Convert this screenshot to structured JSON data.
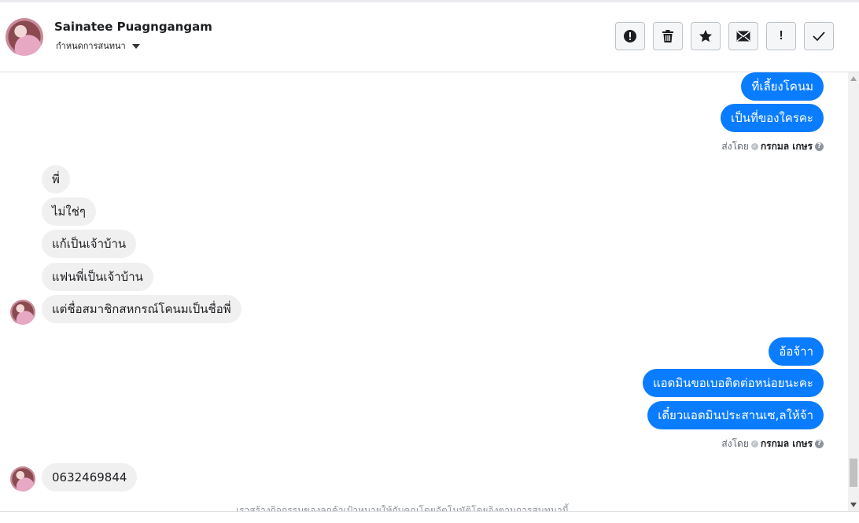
{
  "header": {
    "contact_name": "Sainatee Puagngangam",
    "subtitle": "กำหนดการสนทนา",
    "toolbar": {
      "spam_icon": "exclamation-circle-icon",
      "delete_icon": "trash-icon",
      "star_icon": "star-icon",
      "mail_icon": "envelope-icon",
      "important_label": "!",
      "done_icon": "checkmark-icon"
    }
  },
  "messages": {
    "out1": "ที่เลี้ยงโคนม",
    "out2": "เป็นที่ของใครคะ",
    "sent_by_1": {
      "prefix": "ส่งโดย",
      "sender": "กรกมล เกษร"
    },
    "in1": "พี่",
    "in2": "ไม่ใช่ๆ",
    "in3": "แก้เป็นเจ้าบ้าน",
    "in4": "แฟนพี่เป็นเจ้าบ้าน",
    "in5": "แต่ชื่อสมาชิกสหกรณ์โคนมเป็นชื่อพี่",
    "out3": "อ้อจ้าา",
    "out4": "แอดมินขอเบอติดต่อหน่อยนะคะ",
    "out5": "เดี๋ยวแอดมินประสานเซ,ลให้จ้า",
    "sent_by_2": {
      "prefix": "ส่งโดย",
      "sender": "กรกมล เกษร"
    },
    "in6": "0632469844"
  },
  "footer_note": "เราสร้างกิจกรรมของลูกค้าเป้าหมายให้กับคุณโดยอัตโนมัติโดยอิงตามการสนทนานี้",
  "colors": {
    "outgoing": "#0a7cff",
    "incoming": "#f1f0f0"
  }
}
